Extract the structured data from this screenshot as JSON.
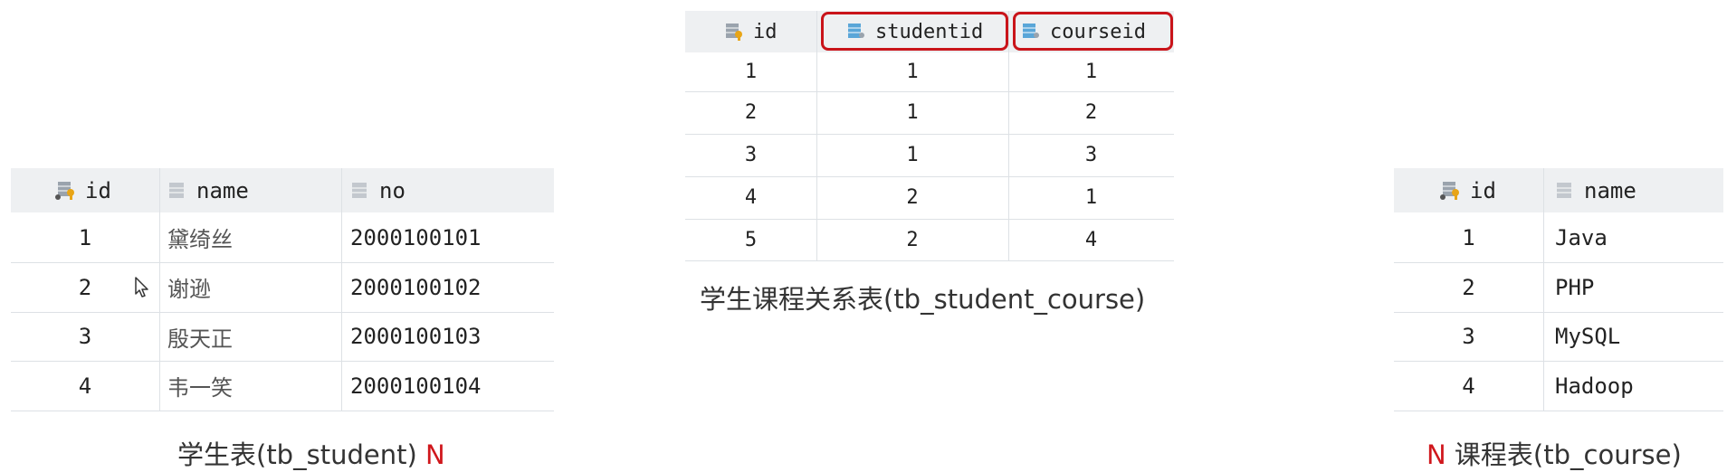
{
  "junction": {
    "headers": [
      "id",
      "studentid",
      "courseid"
    ],
    "rows": [
      [
        "1",
        "1",
        "1"
      ],
      [
        "2",
        "1",
        "2"
      ],
      [
        "3",
        "1",
        "3"
      ],
      [
        "4",
        "2",
        "1"
      ],
      [
        "5",
        "2",
        "4"
      ]
    ],
    "caption": "学生课程关系表(tb_student_course)"
  },
  "student": {
    "headers": [
      "id",
      "name",
      "no"
    ],
    "rows": [
      [
        "1",
        "黛绮丝",
        "2000100101"
      ],
      [
        "2",
        "谢逊",
        "2000100102"
      ],
      [
        "3",
        "殷天正",
        "2000100103"
      ],
      [
        "4",
        "韦一笑",
        "2000100104"
      ]
    ],
    "caption": "学生表(tb_student)",
    "marker": "N"
  },
  "course": {
    "headers": [
      "id",
      "name"
    ],
    "rows": [
      [
        "1",
        "Java"
      ],
      [
        "2",
        "PHP"
      ],
      [
        "3",
        "MySQL"
      ],
      [
        "4",
        "Hadoop"
      ]
    ],
    "caption": "课程表(tb_course)",
    "marker": "N"
  },
  "colors": {
    "highlight": "#c9141a",
    "marker": "#d0171c",
    "header_bg": "#eef0f2"
  },
  "icons": {
    "primary_key_column": "key-column-icon",
    "foreign_key_column": "fk-column-icon",
    "plain_column": "column-icon",
    "cursor": "mouse-pointer-icon"
  }
}
